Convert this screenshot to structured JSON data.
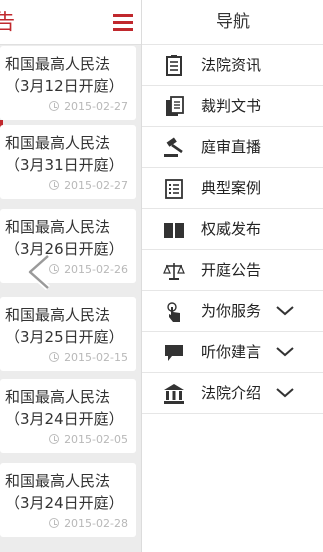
{
  "left_panel": {
    "header_title_fragment": "告",
    "articles": [
      {
        "line1": "和国最高人民法",
        "line2": "（3月12日开庭）",
        "date": "2015-02-27"
      },
      {
        "line1": "和国最高人民法",
        "line2": "（3月31日开庭）",
        "date": "2015-02-27"
      },
      {
        "line1": "和国最高人民法",
        "line2": "（3月26日开庭）",
        "date": "2015-02-26"
      },
      {
        "line1": "和国最高人民法",
        "line2": "（3月25日开庭）",
        "date": "2015-02-15"
      },
      {
        "line1": "和国最高人民法",
        "line2": "（3月24日开庭）",
        "date": "2015-02-05"
      },
      {
        "line1": "和国最高人民法",
        "line2": "（3月24日开庭）",
        "date": "2015-02-28"
      }
    ]
  },
  "nav": {
    "title": "导航",
    "items": [
      {
        "label": "法院资讯",
        "icon": "document-list-icon",
        "expandable": false
      },
      {
        "label": "裁判文书",
        "icon": "documents-icon",
        "expandable": false
      },
      {
        "label": "庭审直播",
        "icon": "gavel-icon",
        "expandable": false
      },
      {
        "label": "典型案例",
        "icon": "checklist-icon",
        "expandable": false
      },
      {
        "label": "权威发布",
        "icon": "book-icon",
        "expandable": false
      },
      {
        "label": "开庭公告",
        "icon": "scales-icon",
        "expandable": false
      },
      {
        "label": "为你服务",
        "icon": "touch-icon",
        "expandable": true
      },
      {
        "label": "听你建言",
        "icon": "speech-bubble-icon",
        "expandable": true
      },
      {
        "label": "法院介绍",
        "icon": "courthouse-icon",
        "expandable": true
      }
    ]
  },
  "colors": {
    "accent": "#c0282d",
    "nav_icon": "#333333"
  }
}
